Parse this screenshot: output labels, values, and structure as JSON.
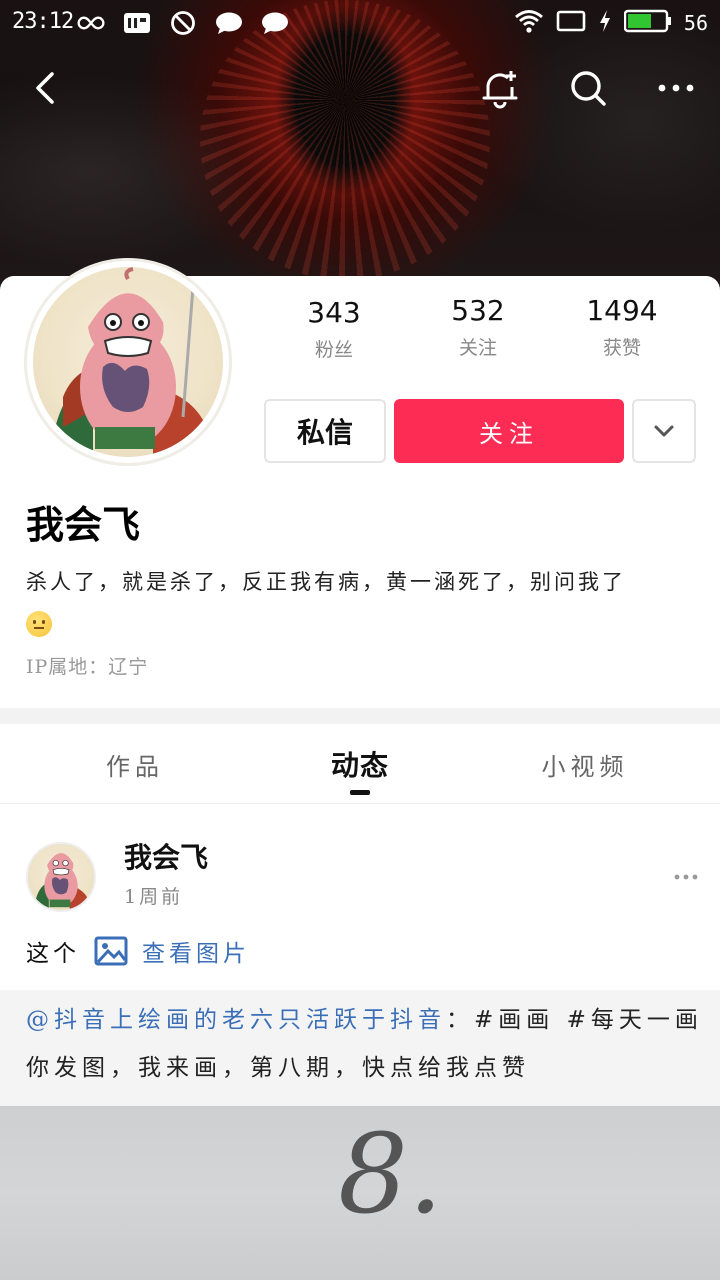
{
  "status_bar": {
    "time": "23:12",
    "battery": "56"
  },
  "profile": {
    "stats": [
      {
        "value": "343",
        "label": "粉丝"
      },
      {
        "value": "532",
        "label": "关注"
      },
      {
        "value": "1494",
        "label": "获赞"
      }
    ],
    "message_button": "私信",
    "follow_button": "关注",
    "username": "我会飞",
    "bio": "杀人了，就是杀了，反正我有病，黄一涵死了，别问我了",
    "ip_location": "IP属地：辽宁"
  },
  "tabs": [
    {
      "label": "作品",
      "active": false
    },
    {
      "label": "动态",
      "active": true
    },
    {
      "label": "小视频",
      "active": false
    }
  ],
  "post": {
    "author": "我会飞",
    "time": "1周前",
    "text": "这个",
    "view_image_label": "查看图片",
    "repost_mention": "@抖音上绘画的老六只活跃于抖音",
    "repost_body": "：#画画 #每天一画 你发图，我来画，第八期，快点给我点赞",
    "image_text": "8."
  },
  "colors": {
    "accent": "#fd2c55",
    "link": "#3a6fb8"
  }
}
